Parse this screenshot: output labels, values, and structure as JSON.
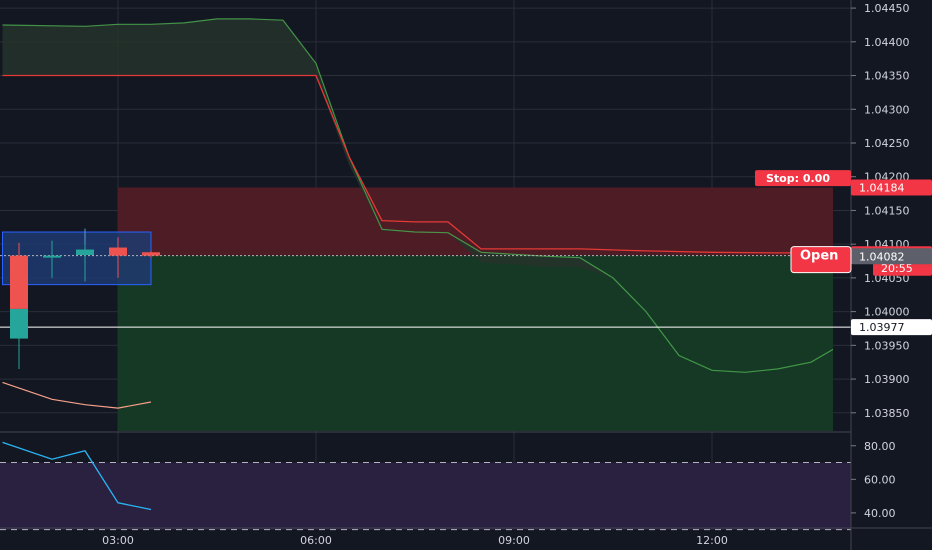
{
  "chart_data": {
    "type": "line",
    "symbol_interval_minutes": 30,
    "price_axis": {
      "ticks": [
        "1.04450",
        "1.04400",
        "1.04350",
        "1.04300",
        "1.04250",
        "1.04200",
        "1.04150",
        "1.04100",
        "1.04050",
        "1.04000",
        "1.03950",
        "1.03900",
        "1.03850"
      ],
      "ylim": [
        1.03823,
        1.04462
      ]
    },
    "time_axis": {
      "ticks": [
        "03:00",
        "06:00",
        "09:00",
        "12:00"
      ],
      "xlim": [
        "01:15",
        "13:50"
      ]
    },
    "candles": [
      {
        "time": "01:30",
        "open": 1.04083,
        "close": 1.04004,
        "high": 1.04102,
        "low": 1.03922,
        "direction": "down"
      },
      {
        "time": "01:30",
        "open": 1.04004,
        "close": 1.0396,
        "high": 1.04004,
        "low": 1.03915,
        "direction": "body"
      },
      {
        "time": "02:00",
        "open": 1.04083,
        "close": 1.04083,
        "high": 1.04105,
        "low": 1.0405,
        "direction": "doji"
      },
      {
        "time": "02:30",
        "open": 1.04087,
        "close": 1.04085,
        "high": 1.04123,
        "low": 1.04045,
        "direction": "doji"
      },
      {
        "time": "02:30",
        "open": 1.04092,
        "close": 1.04084,
        "high": 1.041,
        "low": 1.04045,
        "direction": "up"
      },
      {
        "time": "03:00",
        "open": 1.04095,
        "close": 1.04083,
        "high": 1.0411,
        "low": 1.0405,
        "direction": "down"
      },
      {
        "time": "03:30",
        "open": 1.04088,
        "close": 1.04083,
        "high": 1.0409,
        "low": 1.0408,
        "direction": "down"
      }
    ],
    "indicator_line_values": [
      1.03895,
      1.0387,
      1.03862,
      1.03857,
      1.03866
    ],
    "indicator_line_times": [
      "01:15",
      "02:00",
      "02:30",
      "03:00",
      "03:30"
    ],
    "forecast_band": {
      "times": [
        "01:15",
        "02:30",
        "03:00",
        "03:30",
        "04:00",
        "04:30",
        "05:00",
        "05:30",
        "06:00",
        "06:30",
        "07:00",
        "07:30",
        "08:00",
        "08:30",
        "09:00",
        "09:30",
        "10:00",
        "10:30",
        "11:00",
        "11:30",
        "12:00",
        "12:30",
        "13:00",
        "13:30",
        "13:50"
      ],
      "upper": [
        1.04425,
        1.04423,
        1.04426,
        1.04426,
        1.04428,
        1.04434,
        1.04434,
        1.04432,
        1.04368,
        1.0423,
        1.04122,
        1.04118,
        1.04117,
        1.04088,
        1.04085,
        1.04082,
        1.0408,
        1.0405,
        1.04,
        1.03935,
        1.03913,
        1.0391,
        1.03915,
        1.03925,
        1.03944
      ],
      "lower": [
        1.0435,
        1.0435,
        1.0435,
        1.0435,
        1.0435,
        1.0435,
        1.0435,
        1.0435,
        1.0435,
        1.04218,
        1.0412,
        1.04118,
        1.04117,
        1.04073,
        1.0407,
        1.04066,
        1.04066,
        1.0405,
        1.04,
        1.03935,
        1.03913,
        1.0391,
        1.03915,
        1.03925,
        1.03944
      ],
      "fill_color": "#26332a"
    },
    "red_line": {
      "times": [
        "01:15",
        "06:00",
        "06:30",
        "07:00",
        "07:30",
        "08:00",
        "08:30",
        "09:00",
        "10:00",
        "11:00",
        "12:00",
        "13:00",
        "13:50"
      ],
      "values": [
        1.0435,
        1.0435,
        1.0423,
        1.04135,
        1.04133,
        1.04133,
        1.04093,
        1.04093,
        1.04093,
        1.0409,
        1.04088,
        1.04087,
        1.04087
      ],
      "color": "#e53935"
    },
    "position": {
      "entry_time": "03:00",
      "end_time": "13:50",
      "entry_price": 1.04083,
      "stop_price": 1.04184,
      "target_price": 1.03823,
      "stop_zone_color": "#4d1c25",
      "target_zone_color": "#163925"
    },
    "range_box": {
      "start_time": "01:15",
      "end_time": "03:30",
      "top": 1.04118,
      "bottom": 1.0404,
      "color": "#1e3a70"
    },
    "horizontal_lines": [
      {
        "price": 1.03977,
        "color": "#ffffff"
      },
      {
        "price": 1.04083,
        "color": "#b2b5be",
        "style": "dotted"
      }
    ],
    "price_badges": [
      {
        "label": "Stop: 0.00",
        "price": 1.04198,
        "bg": "#f23645",
        "fg": "#ffffff"
      },
      {
        "label": "1.04184",
        "price": 1.04184,
        "bg": "#f23645",
        "fg": "#ffffff"
      },
      {
        "label": "1.04083",
        "price": 1.04085,
        "bg": "#f23645",
        "fg": "#ffffff"
      },
      {
        "label": "20:55",
        "price": 1.04065,
        "bg": "#f23645",
        "fg": "#ffffff"
      },
      {
        "label": "1.04082",
        "price": 1.04082,
        "bg": "#5d606b",
        "fg": "#ffffff"
      },
      {
        "label": "1.03977",
        "price": 1.03977,
        "bg": "#ffffff",
        "fg": "#131722"
      }
    ],
    "order_label": {
      "text": "Open",
      "price": 1.04083
    },
    "oscillator": {
      "ticks": [
        "80.00",
        "60.00",
        "40.00"
      ],
      "ylim": [
        31,
        87
      ],
      "band": {
        "upper": 70,
        "lower": 30,
        "color": "#2a2040"
      },
      "line_color": "#29b6f6",
      "times": [
        "01:15",
        "02:00",
        "02:30",
        "03:00",
        "03:30"
      ],
      "values": [
        82,
        72,
        77,
        46,
        42
      ]
    },
    "colors": {
      "background": "#131722",
      "grid": "#2a2e39",
      "axis_text": "#d1d4dc",
      "candle_up": "#26a69a",
      "candle_down": "#ef5350"
    }
  }
}
